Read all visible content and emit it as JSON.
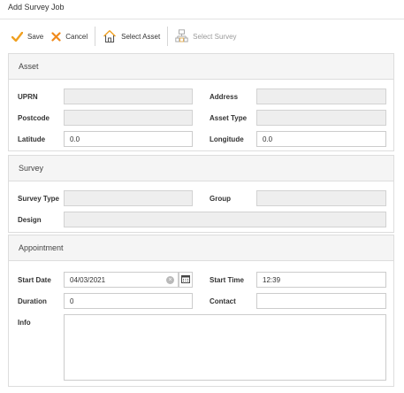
{
  "window": {
    "title": "Add Survey Job"
  },
  "toolbar": {
    "save_label": "Save",
    "cancel_label": "Cancel",
    "select_asset_label": "Select Asset",
    "select_survey_label": "Select Survey",
    "select_survey_enabled": false
  },
  "asset": {
    "heading": "Asset",
    "uprn_label": "UPRN",
    "uprn_value": "",
    "address_label": "Address",
    "address_value": "",
    "postcode_label": "Postcode",
    "postcode_value": "",
    "asset_type_label": "Asset Type",
    "asset_type_value": "",
    "latitude_label": "Latitude",
    "latitude_value": "0.0",
    "longitude_label": "Longitude",
    "longitude_value": "0.0"
  },
  "survey": {
    "heading": "Survey",
    "survey_type_label": "Survey Type",
    "survey_type_value": "",
    "group_label": "Group",
    "group_value": "",
    "design_label": "Design",
    "design_value": ""
  },
  "appointment": {
    "heading": "Appointment",
    "start_date_label": "Start Date",
    "start_date_value": "04/03/2021",
    "start_time_label": "Start Time",
    "start_time_value": "12:39",
    "duration_label": "Duration",
    "duration_value": "0",
    "contact_label": "Contact",
    "contact_value": "",
    "info_label": "Info",
    "info_value": ""
  },
  "colors": {
    "save_check": "#f0a020",
    "cancel_x": "#f08a1c",
    "panel_header_bg": "#f5f5f5",
    "readonly_bg": "#eeeeee",
    "border": "#dddddd"
  }
}
